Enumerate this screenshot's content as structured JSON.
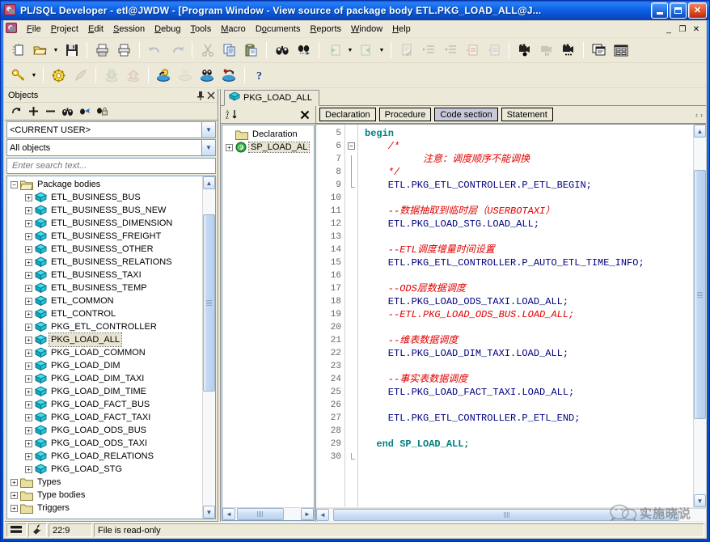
{
  "window": {
    "title": "PL/SQL Developer - etl@JWDW - [Program Window - View source of package body ETL.PKG_LOAD_ALL@J...",
    "app_icon": "plsql-developer-icon",
    "minimize_label": "",
    "maximize_label": "",
    "close_label": "✕"
  },
  "menu": {
    "items": [
      {
        "label": "File",
        "accel": "F"
      },
      {
        "label": "Project",
        "accel": "P"
      },
      {
        "label": "Edit",
        "accel": "E"
      },
      {
        "label": "Session",
        "accel": "S"
      },
      {
        "label": "Debug",
        "accel": "D"
      },
      {
        "label": "Tools",
        "accel": "T"
      },
      {
        "label": "Macro",
        "accel": "M"
      },
      {
        "label": "Documents",
        "accel": "o"
      },
      {
        "label": "Reports",
        "accel": "R"
      },
      {
        "label": "Window",
        "accel": "W"
      },
      {
        "label": "Help",
        "accel": "H"
      }
    ],
    "mdi_buttons": [
      "_",
      "❐",
      "✕"
    ]
  },
  "toolbar_top": {
    "buttons": [
      "new-document-icon",
      "open-folder-icon",
      "open-dropdown-arrow",
      "save-icon",
      "print-icon",
      "print-preview-icon",
      "undo-icon",
      "redo-icon",
      "cut-icon",
      "copy-icon",
      "paste-icon",
      "find-icon",
      "find-next-icon",
      "previous-document-icon",
      "previous-dropdown-arrow",
      "next-document-icon",
      "next-dropdown-arrow",
      "check-syntax-icon",
      "indent-icon",
      "outdent-icon",
      "comment-icon",
      "uncomment-icon",
      "record-macro-icon",
      "pause-macro-icon",
      "macro-list-icon",
      "cascade-windows-icon",
      "tile-windows-icon"
    ]
  },
  "toolbar_second": {
    "buttons": [
      "login-key-icon",
      "login-dropdown-arrow",
      "preferences-gear-icon",
      "quill-icon",
      "import-icon",
      "export-icon",
      "execute-icon",
      "sql-icon",
      "explain-plan-icon",
      "rollback-icon",
      "help-question-icon"
    ]
  },
  "objects_pane": {
    "title": "Objects",
    "pin_icon": "pin-icon",
    "close_icon": "close-icon",
    "toolbar_icons": [
      "refresh-icon",
      "expand-all-icon",
      "collapse-all-icon",
      "find-icon",
      "filter-icon",
      "lock-icon"
    ],
    "user_combo": "<CURRENT USER>",
    "filter_combo": "All objects",
    "search_placeholder": "Enter search text...",
    "tree": {
      "root_label": "Package bodies",
      "root_icon": "folder-open-icon",
      "packages": [
        "ETL_BUSINESS_BUS",
        "ETL_BUSINESS_BUS_NEW",
        "ETL_BUSINESS_DIMENSION",
        "ETL_BUSINESS_FREIGHT",
        "ETL_BUSINESS_OTHER",
        "ETL_BUSINESS_RELATIONS",
        "ETL_BUSINESS_TAXI",
        "ETL_BUSINESS_TEMP",
        "ETL_COMMON",
        "ETL_CONTROL",
        "PKG_ETL_CONTROLLER",
        "PKG_LOAD_ALL",
        "PKG_LOAD_COMMON",
        "PKG_LOAD_DIM",
        "PKG_LOAD_DIM_TAXI",
        "PKG_LOAD_DIM_TIME",
        "PKG_LOAD_FACT_BUS",
        "PKG_LOAD_FACT_TAXI",
        "PKG_LOAD_ODS_BUS",
        "PKG_LOAD_ODS_TAXI",
        "PKG_LOAD_RELATIONS",
        "PKG_LOAD_STG"
      ],
      "selected_package": "PKG_LOAD_ALL",
      "other_folders": [
        "Types",
        "Type bodies",
        "Triggers"
      ]
    }
  },
  "child_window": {
    "tab_label": "PKG_LOAD_ALL",
    "tab_icon": "package-icon"
  },
  "outline_pane": {
    "sort_icon": "sort-az-icon",
    "close_icon": "close-icon",
    "nodes": [
      {
        "label": "Declaration",
        "icon": "folder-icon",
        "expandable": false
      },
      {
        "label": "SP_LOAD_AL",
        "icon": "procedure-icon",
        "expandable": true,
        "selected": true
      }
    ]
  },
  "code_sections": {
    "tabs": [
      {
        "label": "Declaration",
        "active": false
      },
      {
        "label": "Procedure",
        "active": false
      },
      {
        "label": "Code section",
        "active": true
      },
      {
        "label": "Statement",
        "active": false
      }
    ],
    "nav_prev": "‹",
    "nav_next": "›"
  },
  "editor": {
    "first_line": 5,
    "lines": [
      {
        "n": 5,
        "fold": "none",
        "segments": [
          {
            "t": "begin",
            "c": "kw",
            "indent": 0
          }
        ]
      },
      {
        "n": 6,
        "fold": "minus",
        "segments": [
          {
            "t": "/*",
            "c": "cm",
            "indent": 2
          }
        ]
      },
      {
        "n": 7,
        "fold": "line",
        "segments": [
          {
            "t": "注意：调度顺序不能调换",
            "c": "cm",
            "indent": 5
          }
        ]
      },
      {
        "n": 8,
        "fold": "line",
        "segments": [
          {
            "t": "*/",
            "c": "cm",
            "indent": 2
          }
        ]
      },
      {
        "n": 9,
        "fold": "end",
        "segments": [
          {
            "t": "ETL.PKG_ETL_CONTROLLER.P_ETL_BEGIN;",
            "c": "code",
            "indent": 2
          }
        ]
      },
      {
        "n": 10,
        "fold": "none",
        "segments": []
      },
      {
        "n": 11,
        "fold": "none",
        "segments": [
          {
            "t": "--数据抽取到临时层（USERBOTAXI）",
            "c": "cm",
            "indent": 2
          }
        ]
      },
      {
        "n": 12,
        "fold": "none",
        "segments": [
          {
            "t": "ETL.PKG_LOAD_STG.LOAD_ALL;",
            "c": "code",
            "indent": 2
          }
        ]
      },
      {
        "n": 13,
        "fold": "none",
        "segments": []
      },
      {
        "n": 14,
        "fold": "none",
        "segments": [
          {
            "t": "--ETL调度增量时间设置",
            "c": "cm",
            "indent": 2
          }
        ]
      },
      {
        "n": 15,
        "fold": "none",
        "segments": [
          {
            "t": "ETL.PKG_ETL_CONTROLLER.P_AUTO_ETL_TIME_INFO;",
            "c": "code",
            "indent": 2
          }
        ]
      },
      {
        "n": 16,
        "fold": "none",
        "segments": []
      },
      {
        "n": 17,
        "fold": "none",
        "segments": [
          {
            "t": "--ODS层数据调度",
            "c": "cm",
            "indent": 2
          }
        ]
      },
      {
        "n": 18,
        "fold": "none",
        "segments": [
          {
            "t": "ETL.PKG_LOAD_ODS_TAXI.LOAD_ALL;",
            "c": "code",
            "indent": 2
          }
        ]
      },
      {
        "n": 19,
        "fold": "none",
        "segments": [
          {
            "t": "--ETL.PKG_LOAD_ODS_BUS.LOAD_ALL;",
            "c": "cm",
            "indent": 2
          }
        ]
      },
      {
        "n": 20,
        "fold": "none",
        "segments": []
      },
      {
        "n": 21,
        "fold": "none",
        "segments": [
          {
            "t": "--维表数据调度",
            "c": "cm",
            "indent": 2
          }
        ]
      },
      {
        "n": 22,
        "fold": "none",
        "segments": [
          {
            "t": "ETL.PKG_LOAD_DIM_TAXI.LOAD_ALL;",
            "c": "code",
            "indent": 2
          }
        ]
      },
      {
        "n": 23,
        "fold": "none",
        "segments": []
      },
      {
        "n": 24,
        "fold": "none",
        "segments": [
          {
            "t": "--事实表数据调度",
            "c": "cm",
            "indent": 2
          }
        ]
      },
      {
        "n": 25,
        "fold": "none",
        "segments": [
          {
            "t": "ETL.PKG_LOAD_FACT_TAXI.LOAD_ALL;",
            "c": "code",
            "indent": 2
          }
        ]
      },
      {
        "n": 26,
        "fold": "none",
        "segments": []
      },
      {
        "n": 27,
        "fold": "none",
        "segments": [
          {
            "t": "ETL.PKG_ETL_CONTROLLER.P_ETL_END;",
            "c": "code",
            "indent": 2
          }
        ]
      },
      {
        "n": 28,
        "fold": "none",
        "segments": []
      },
      {
        "n": 29,
        "fold": "none",
        "segments": [
          {
            "t": "end SP_LOAD_ALL;",
            "c": "kw",
            "indent": 1
          }
        ]
      },
      {
        "n": 30,
        "fold": "endbox",
        "segments": []
      }
    ]
  },
  "status_bar": {
    "mode_icon": "insert-mode-icon",
    "tool_icon": "wrench-icon",
    "cursor_position": "22:9",
    "message": "File is read-only"
  },
  "watermark": {
    "logo": "wechat-icon",
    "text": "实施晓说"
  },
  "colors": {
    "title_blue": "#0a5ae0",
    "chrome": "#ece9d8",
    "keyword": "#008080",
    "comment": "#e00000",
    "code": "#000080",
    "selection": "#e8e4d0"
  }
}
